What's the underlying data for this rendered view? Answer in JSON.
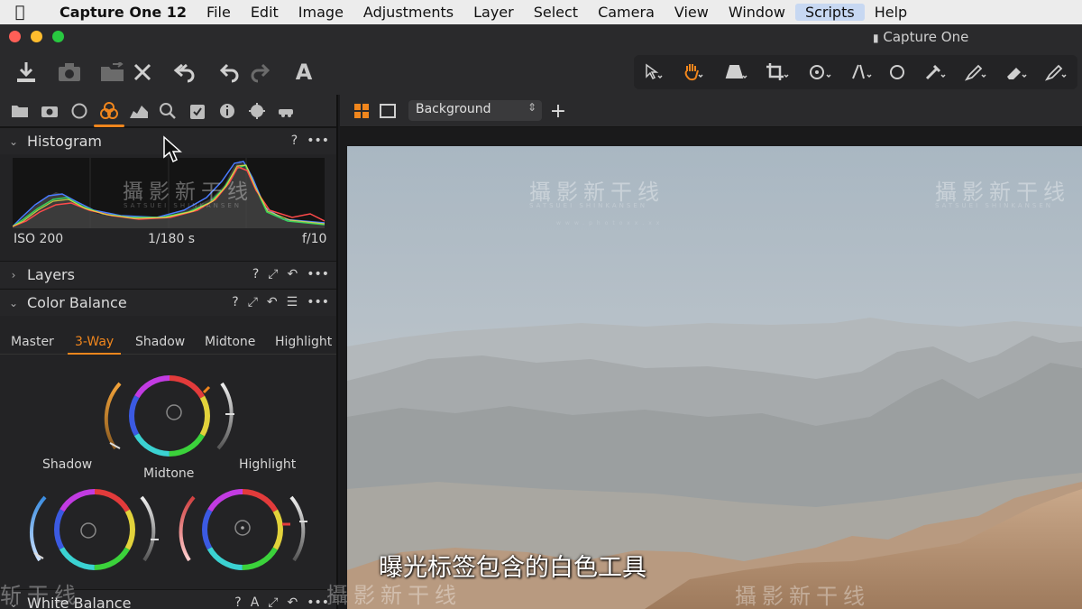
{
  "menubar": {
    "app_name": "Capture One 12",
    "items": [
      "File",
      "Edit",
      "Image",
      "Adjustments",
      "Layer",
      "Select",
      "Camera",
      "View",
      "Window",
      "Scripts",
      "Help"
    ],
    "highlighted": "Scripts"
  },
  "window": {
    "title": "Capture One"
  },
  "toolbar": {
    "text_tool_label": "A",
    "icons": [
      "import-icon",
      "camera-icon",
      "move-folder-icon",
      "delete-icon",
      "undo-all-icon",
      "undo-icon",
      "redo-icon",
      "text-icon"
    ],
    "cursor_tools": [
      "select-cursor-icon",
      "pan-hand-icon",
      "keystone-icon",
      "crop-icon",
      "rotate-icon",
      "straighten-icon",
      "spot-removal-icon",
      "picker-icon",
      "brush-icon",
      "eraser-icon",
      "gradient-icon"
    ],
    "active_cursor_tool": "pan-hand-icon"
  },
  "tool_tabs": {
    "icons": [
      "library-icon",
      "capture-icon",
      "lens-icon",
      "color-icon",
      "exposure-icon",
      "details-icon",
      "adjustments-icon",
      "metadata-icon",
      "output-icon",
      "batch-icon"
    ],
    "active": "color-icon"
  },
  "histogram": {
    "title": "Histogram",
    "iso": "ISO 200",
    "shutter": "1/180 s",
    "aperture": "f/10",
    "help": "?",
    "menu": "•••"
  },
  "layers": {
    "title": "Layers",
    "help": "?",
    "menu": "•••"
  },
  "color_balance": {
    "title": "Color Balance",
    "help": "?",
    "menu": "•••",
    "tabs": [
      "Master",
      "3-Way",
      "Shadow",
      "Midtone",
      "Highlight"
    ],
    "active_tab": "3-Way",
    "wheels": {
      "shadow": "Shadow",
      "midtone": "Midtone",
      "highlight": "Highlight"
    }
  },
  "white_balance": {
    "title": "White Balance",
    "help": "?",
    "auto": "A",
    "menu": "•••"
  },
  "viewer": {
    "variant": "Background",
    "add_label": "+"
  },
  "watermark": {
    "text": "攝影新干线",
    "sub": "SATSUEI SHINKANSEN",
    "url": "www.photoxx.xx",
    "partial_left": "斩干线",
    "partial_bottom": "攝影新干线"
  },
  "subtitle": "曝光标签包含的白色工具",
  "colors": {
    "accent": "#f0861d",
    "panel": "#232325",
    "toolbar": "#2a2a2c"
  }
}
